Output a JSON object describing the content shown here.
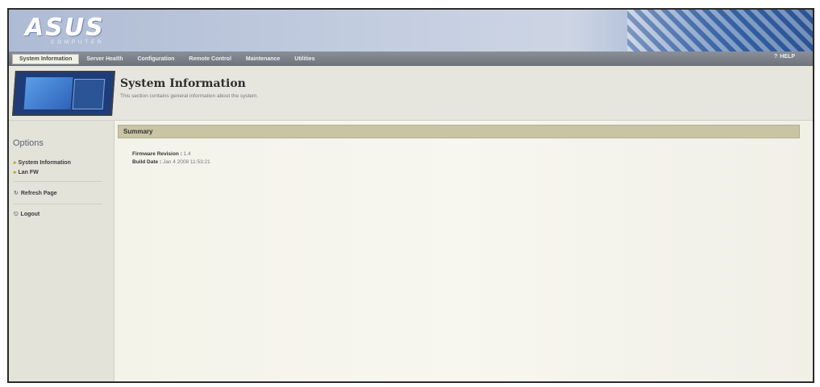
{
  "header": {
    "logo": "ASUS",
    "logo_sub": "COMPUTER"
  },
  "menu": {
    "items": [
      {
        "label": "System Information"
      },
      {
        "label": "Server Health"
      },
      {
        "label": "Configuration"
      },
      {
        "label": "Remote Control"
      },
      {
        "label": "Maintenance"
      },
      {
        "label": "Utilities"
      }
    ],
    "help_label": "HELP",
    "active_index": 0
  },
  "page": {
    "title": "System Information",
    "description": "This section contains general information about the system."
  },
  "sidebar": {
    "title": "Options",
    "items": [
      {
        "label": "System Information",
        "icon": "arrow-icon"
      },
      {
        "label": "Lan FW",
        "icon": "arrow-icon"
      },
      {
        "label": "Refresh Page",
        "icon": "refresh-icon"
      },
      {
        "label": "Logout",
        "icon": "logout-icon"
      }
    ]
  },
  "summary": {
    "heading": "Summary",
    "rows": [
      {
        "label": "Firmware Revision :",
        "value": "1.4"
      },
      {
        "label": "Build Date :",
        "value": "Jan 4 2008 11:53:21"
      }
    ]
  },
  "colors": {
    "accent": "#c8c4a4",
    "menubar": "#7a7f88",
    "banner_blue": "#3d6aa8"
  }
}
